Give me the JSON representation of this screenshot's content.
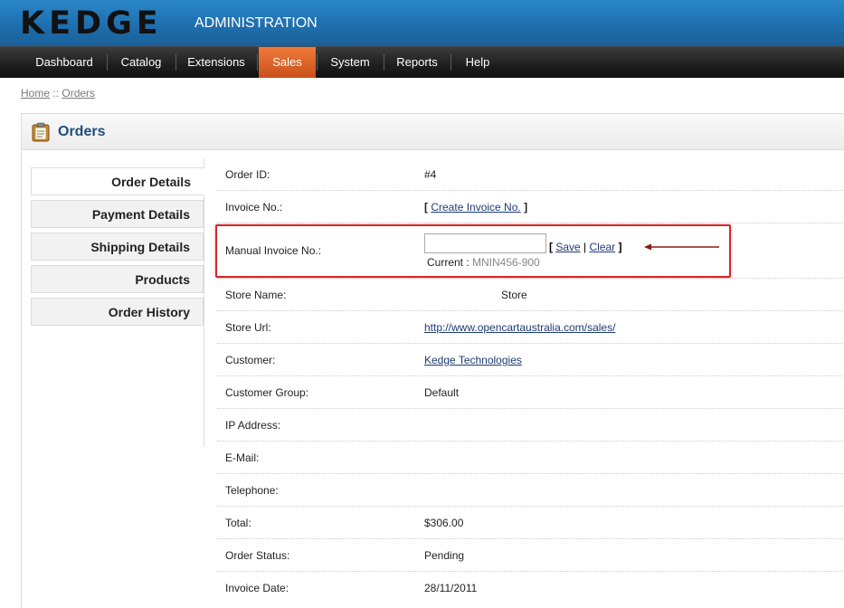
{
  "header": {
    "logo": "KEDGE",
    "subtitle": "ADMINISTRATION"
  },
  "menu": {
    "items": [
      {
        "label": "Dashboard"
      },
      {
        "label": "Catalog"
      },
      {
        "label": "Extensions"
      },
      {
        "label": "Sales",
        "active": true
      },
      {
        "label": "System"
      },
      {
        "label": "Reports"
      },
      {
        "label": "Help"
      }
    ]
  },
  "breadcrumb": {
    "home": "Home",
    "separator": " :: ",
    "current": "Orders"
  },
  "box": {
    "title": "Orders"
  },
  "tabs": [
    {
      "label": "Order Details",
      "selected": true
    },
    {
      "label": "Payment Details"
    },
    {
      "label": "Shipping Details"
    },
    {
      "label": "Products"
    },
    {
      "label": "Order History"
    }
  ],
  "fields": {
    "order_id": {
      "label": "Order ID:",
      "value": "#4"
    },
    "invoice_no": {
      "label": "Invoice No.:",
      "bracket_open": "[ ",
      "link": "Create Invoice No.",
      "bracket_close": " ]"
    },
    "manual_invoice": {
      "label": "Manual Invoice No.:",
      "input_value": "",
      "bracket_open": "[ ",
      "save": "Save",
      "pipe": " | ",
      "clear": "Clear",
      "bracket_close": " ]",
      "current_label": "Current : ",
      "current_value": "MNIN456-900"
    },
    "store_name": {
      "label": "Store Name:",
      "value": "Store"
    },
    "store_url": {
      "label": "Store Url:",
      "value": "http://www.opencartaustralia.com/sales/"
    },
    "customer": {
      "label": "Customer:",
      "value": "Kedge Technologies"
    },
    "customer_group": {
      "label": "Customer Group:",
      "value": "Default"
    },
    "ip_address": {
      "label": "IP Address:",
      "value": ""
    },
    "email": {
      "label": "E-Mail:",
      "value": ""
    },
    "telephone": {
      "label": "Telephone:",
      "value": ""
    },
    "total": {
      "label": "Total:",
      "value": "$306.00"
    },
    "order_status": {
      "label": "Order Status:",
      "value": "Pending"
    },
    "invoice_date": {
      "label": "Invoice Date:",
      "value": "28/11/2011"
    }
  },
  "colors": {
    "header_blue": "#1f6fae",
    "menu_active": "#e06428",
    "highlight_red": "#d6262a",
    "title_blue": "#1f4d7a",
    "link": "#1d3b72"
  }
}
